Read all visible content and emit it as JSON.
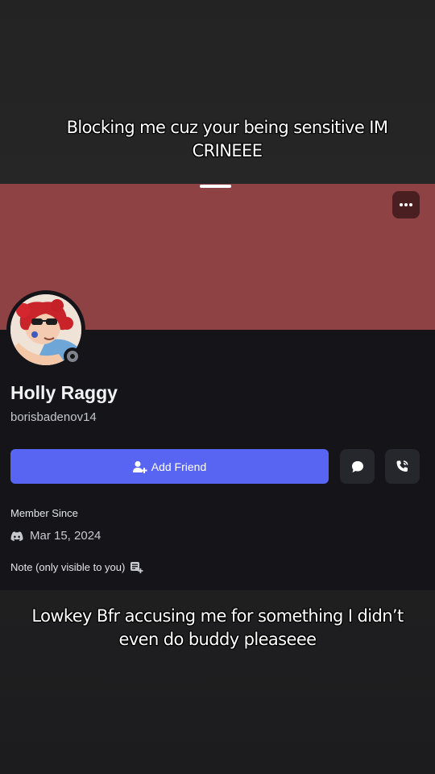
{
  "overlay": {
    "top_caption": "Blocking me cuz your being sensitive IM CRINEEE",
    "bottom_caption": "Lowkey Bfr accusing me for something I didn’t even do buddy  pleaseee"
  },
  "profile": {
    "display_name": "Holly Raggy",
    "username": "borisbadenov14",
    "banner_color": "#8f4244",
    "status": "offline",
    "add_friend_label": "Add Friend",
    "member_since_label": "Member Since",
    "member_since_date": "Mar 15, 2024",
    "note_label": "Note (only visible to you)"
  },
  "icons": {
    "more": "more-icon",
    "add_friend": "add-friend-icon",
    "message": "message-icon",
    "call": "phone-icon",
    "discord": "discord-icon",
    "note": "note-icon"
  },
  "colors": {
    "accent": "#5865f2",
    "background": "#151519"
  }
}
